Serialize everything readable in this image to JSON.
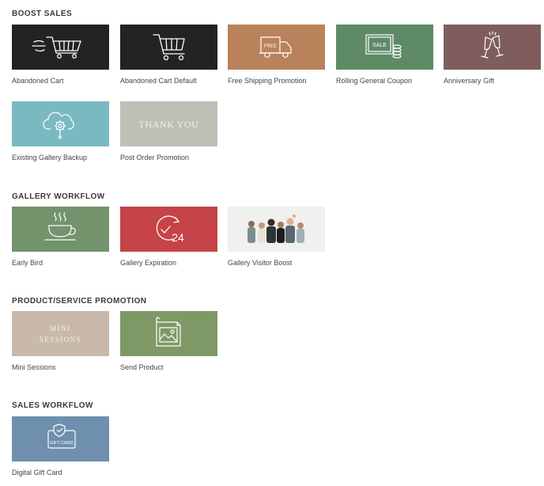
{
  "colors": {
    "dark": "#232323",
    "copper": "#b9825a",
    "green": "#5f8a66",
    "mauve": "#7f5d5c",
    "teal": "#7bb9c1",
    "grey": "#bfbfb8",
    "sage": "#73936d",
    "red": "#c64347",
    "light": "#f0f0ef",
    "taupe": "#c8b9ab",
    "olive": "#7e9866",
    "slate": "#6e8fad"
  },
  "sections": [
    {
      "title": "BOOST SALES",
      "items": [
        {
          "label": "Abandoned Cart",
          "icon": "fast-cart-icon"
        },
        {
          "label": "Abandoned Cart Default",
          "icon": "cart-icon"
        },
        {
          "label": "Free Shipping Promotion",
          "icon": "truck-icon",
          "icon_text": "FREE"
        },
        {
          "label": "Rolling General Coupon",
          "icon": "sale-coupon-icon",
          "icon_text": "SALE"
        },
        {
          "label": "Anniversary Gift",
          "icon": "champagne-icon"
        },
        {
          "label": "Existing Gallery Backup",
          "icon": "cloud-gear-icon"
        },
        {
          "label": "Post Order Promotion",
          "thumb_text": "THANK YOU"
        }
      ]
    },
    {
      "title": "GALLERY WORKFLOW",
      "items": [
        {
          "label": "Early Bird",
          "icon": "coffee-cup-icon"
        },
        {
          "label": "Gallery Expiration",
          "icon": "clock-24-icon",
          "icon_text": "24"
        },
        {
          "label": "Gallery Visitor Boost",
          "icon": "people-photo-icon"
        }
      ]
    },
    {
      "title": "PRODUCT/SERVICE PROMOTION",
      "items": [
        {
          "label": "Mini Sessions",
          "thumb_text_lines": [
            "MINI",
            "SESSIONS"
          ]
        },
        {
          "label": "Send Product",
          "icon": "photo-print-icon"
        }
      ]
    },
    {
      "title": "SALES WORKFLOW",
      "items": [
        {
          "label": "Digital Gift Card",
          "icon": "gift-card-icon",
          "icon_text": "GIFT CARD"
        }
      ]
    }
  ]
}
